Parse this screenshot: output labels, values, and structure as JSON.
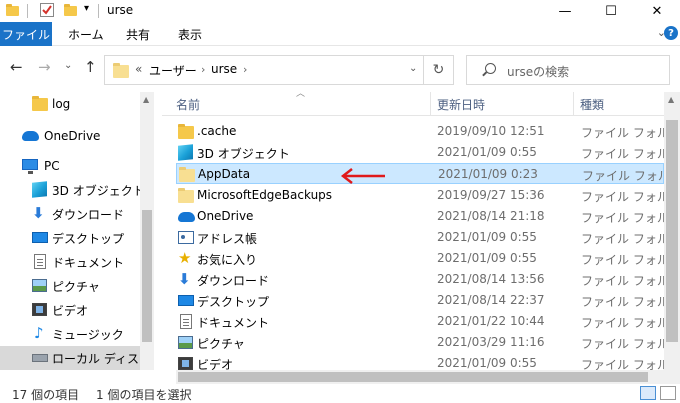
{
  "window": {
    "title": "urse",
    "minimize": "—",
    "maximize": "☐",
    "close": "✕"
  },
  "ribbon": {
    "tabs": [
      {
        "label": "ファイル"
      },
      {
        "label": "ホーム"
      },
      {
        "label": "共有"
      },
      {
        "label": "表示"
      }
    ],
    "help": "?"
  },
  "address": {
    "path_prefix": "«",
    "crumbs": [
      "ユーザー",
      "urse"
    ],
    "search_placeholder": "urseの検索"
  },
  "nav": {
    "items": [
      {
        "label": "log",
        "icon": "folder-icon"
      },
      {
        "label": "OneDrive",
        "icon": "cloud-icon"
      },
      {
        "label": "PC",
        "icon": "pc-icon"
      },
      {
        "label": "3D オブジェクト",
        "icon": "cube-icon"
      },
      {
        "label": "ダウンロード",
        "icon": "download-icon"
      },
      {
        "label": "デスクトップ",
        "icon": "desktop-icon"
      },
      {
        "label": "ドキュメント",
        "icon": "document-icon"
      },
      {
        "label": "ピクチャ",
        "icon": "picture-icon"
      },
      {
        "label": "ビデオ",
        "icon": "video-icon"
      },
      {
        "label": "ミュージック",
        "icon": "music-icon"
      },
      {
        "label": "ローカル ディスク (C",
        "icon": "disk-icon"
      }
    ]
  },
  "columns": {
    "name": "名前",
    "date": "更新日時",
    "type": "種類"
  },
  "files": [
    {
      "name": ".cache",
      "date": "2019/09/10 12:51",
      "type": "ファイル フォルダー",
      "icon": "folder-icon"
    },
    {
      "name": "3D オブジェクト",
      "date": "2021/01/09 0:55",
      "type": "ファイル フォルダー",
      "icon": "cube-icon"
    },
    {
      "name": "AppData",
      "date": "2021/01/09 0:23",
      "type": "ファイル フォルダー",
      "icon": "folder-light-icon"
    },
    {
      "name": "MicrosoftEdgeBackups",
      "date": "2019/09/27 15:36",
      "type": "ファイル フォルダー",
      "icon": "folder-light-icon"
    },
    {
      "name": "OneDrive",
      "date": "2021/08/14 21:18",
      "type": "ファイル フォルダー",
      "icon": "cloud-icon"
    },
    {
      "name": "アドレス帳",
      "date": "2021/01/09 0:55",
      "type": "ファイル フォルダー",
      "icon": "contacts-icon"
    },
    {
      "name": "お気に入り",
      "date": "2021/01/09 0:55",
      "type": "ファイル フォルダー",
      "icon": "star-icon"
    },
    {
      "name": "ダウンロード",
      "date": "2021/08/14 13:56",
      "type": "ファイル フォルダー",
      "icon": "download-icon"
    },
    {
      "name": "デスクトップ",
      "date": "2021/08/14 22:37",
      "type": "ファイル フォルダー",
      "icon": "desktop-icon"
    },
    {
      "name": "ドキュメント",
      "date": "2021/01/22 10:44",
      "type": "ファイル フォルダー",
      "icon": "document-icon"
    },
    {
      "name": "ピクチャ",
      "date": "2021/03/29 11:16",
      "type": "ファイル フォルダー",
      "icon": "picture-icon"
    },
    {
      "name": "ビデオ",
      "date": "2021/01/09 0:55",
      "type": "ファイル フォルダー",
      "icon": "video-icon"
    }
  ],
  "selected_file": "AppData",
  "status": {
    "count": "17 個の項目",
    "selection": "1 個の項目を選択"
  },
  "colors": {
    "accent": "#1a73c8",
    "selection": "#cce8ff",
    "arrow": "#e0191b"
  }
}
